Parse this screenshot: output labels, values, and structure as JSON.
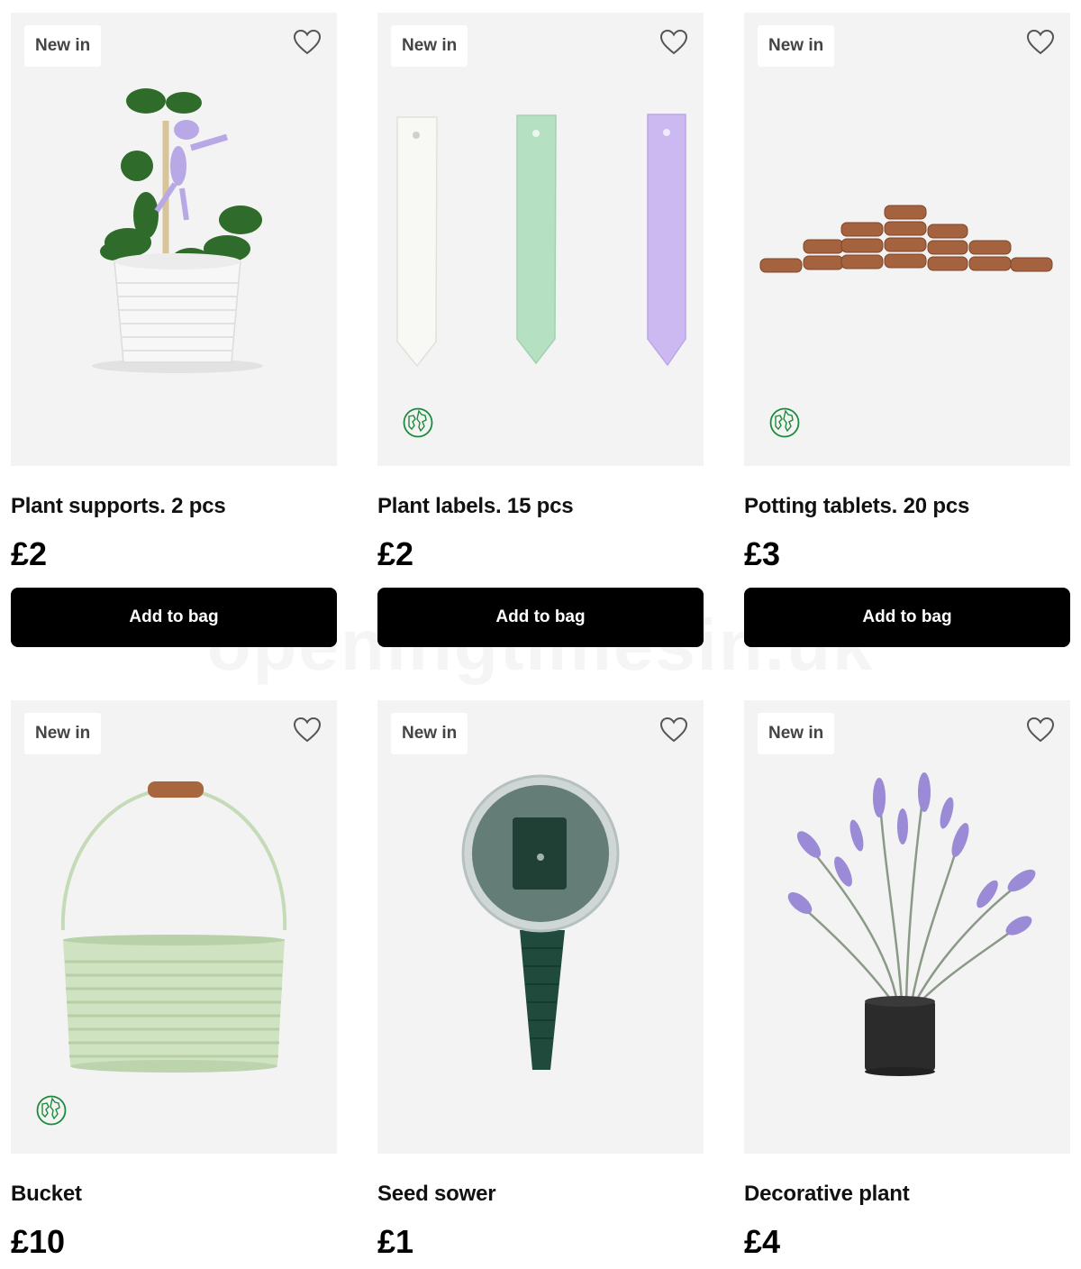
{
  "watermark": "openingtimesin.uk",
  "products": [
    {
      "badge": "New in",
      "title": "Plant supports. 2 pcs",
      "price": "£2",
      "cta": "Add to bag",
      "eco": false
    },
    {
      "badge": "New in",
      "title": "Plant labels. 15 pcs",
      "price": "£2",
      "cta": "Add to bag",
      "eco": true
    },
    {
      "badge": "New in",
      "title": "Potting tablets. 20 pcs",
      "price": "£3",
      "cta": "Add to bag",
      "eco": true
    },
    {
      "badge": "New in",
      "title": "Bucket",
      "price": "£10",
      "eco": true
    },
    {
      "badge": "New in",
      "title": "Seed sower",
      "price": "£1",
      "eco": false
    },
    {
      "badge": "New in",
      "title": "Decorative plant",
      "price": "£4",
      "eco": false
    }
  ],
  "colors": {
    "accent": "#000000",
    "image_bg": "#f3f3f3",
    "eco_green": "#1c8a3c"
  },
  "icons": {
    "favourite": "heart-outline-icon",
    "eco": "globe-eco-icon"
  }
}
